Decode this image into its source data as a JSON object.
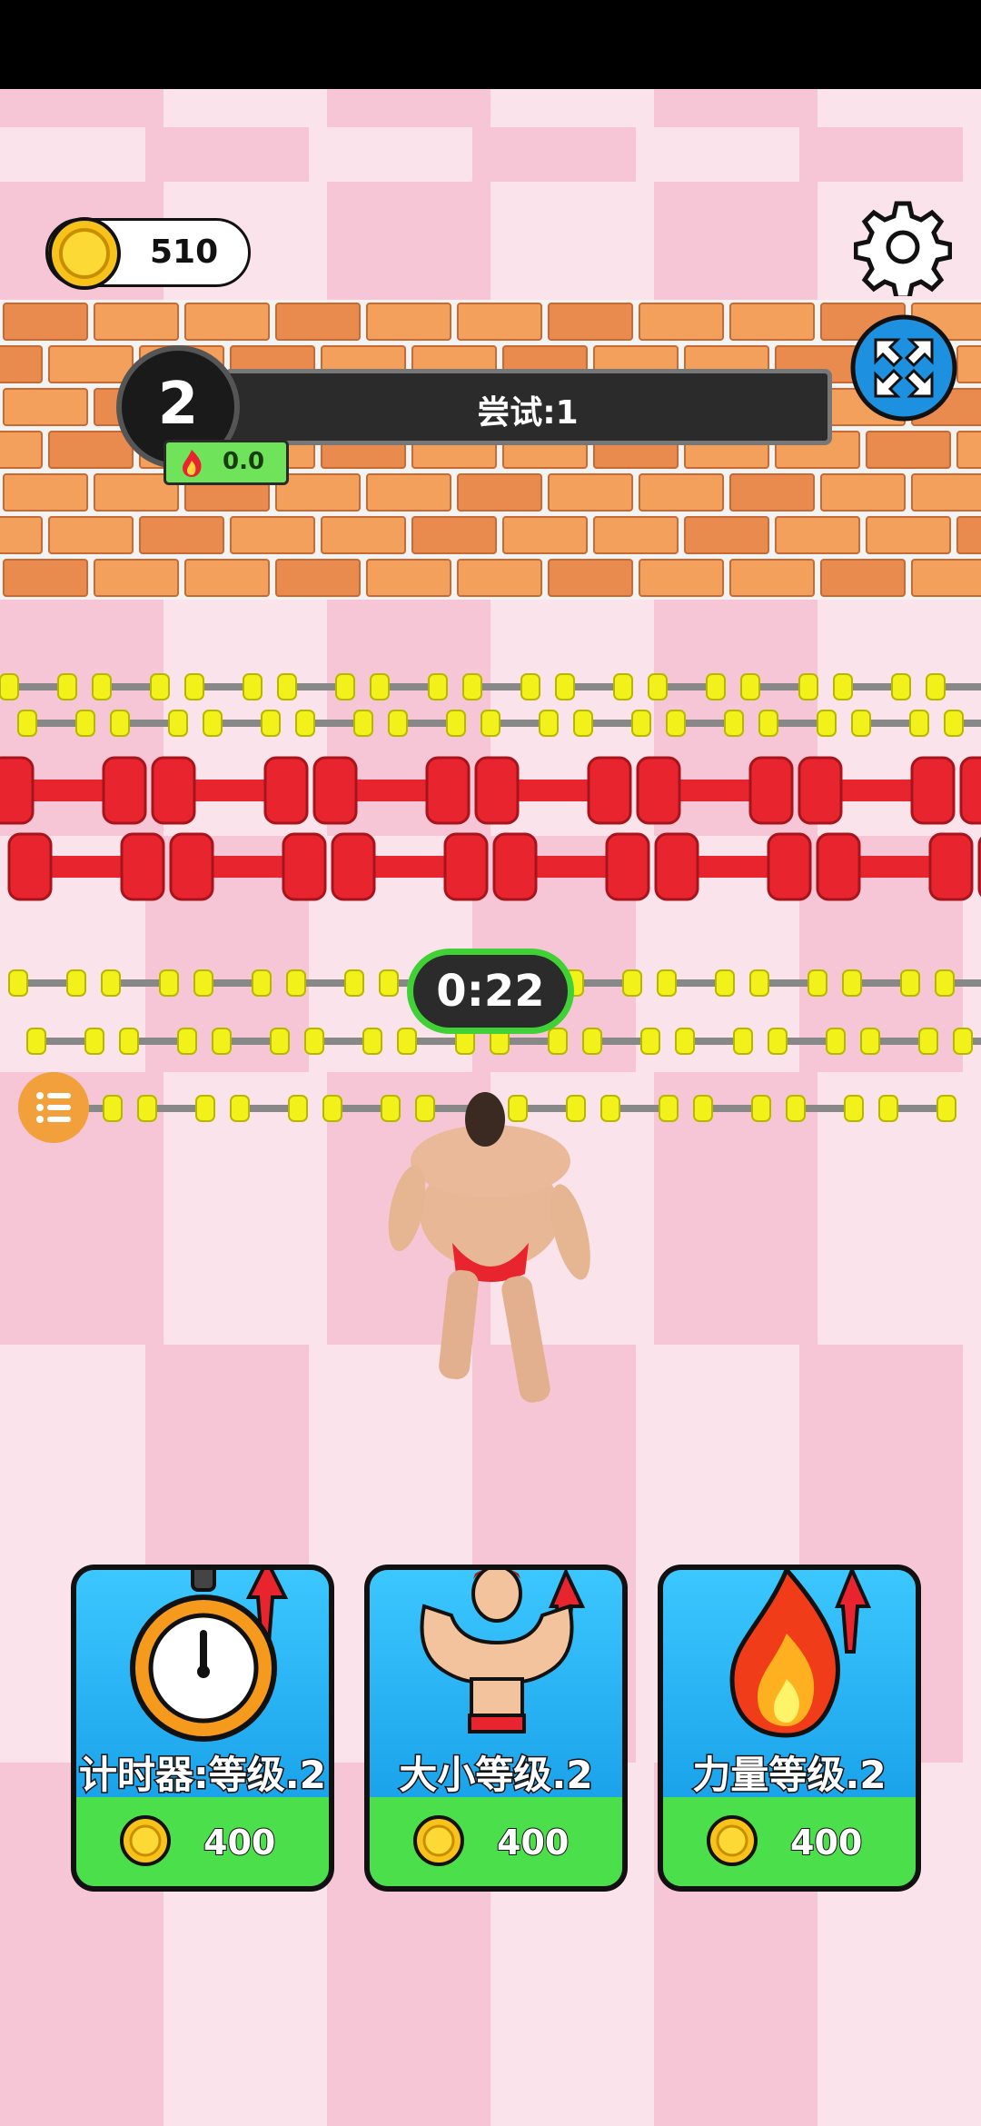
{
  "hud": {
    "coins": "510",
    "level": "2",
    "attempt": "尝试:1",
    "power": "0.0",
    "timer": "0:22"
  },
  "upgrades": [
    {
      "label": "计时器:等级.2",
      "price": "400",
      "icon": "stopwatch-icon"
    },
    {
      "label": "大小等级.2",
      "price": "400",
      "icon": "muscle-icon"
    },
    {
      "label": "力量等级.2",
      "price": "400",
      "icon": "fire-icon"
    }
  ],
  "colors": {
    "accent_green": "#3fd136",
    "card_blue": "#29b6f6",
    "card_green": "#4be04b",
    "dumbbell_red": "#e8242e",
    "dumbbell_yellow": "#f2f21a"
  }
}
